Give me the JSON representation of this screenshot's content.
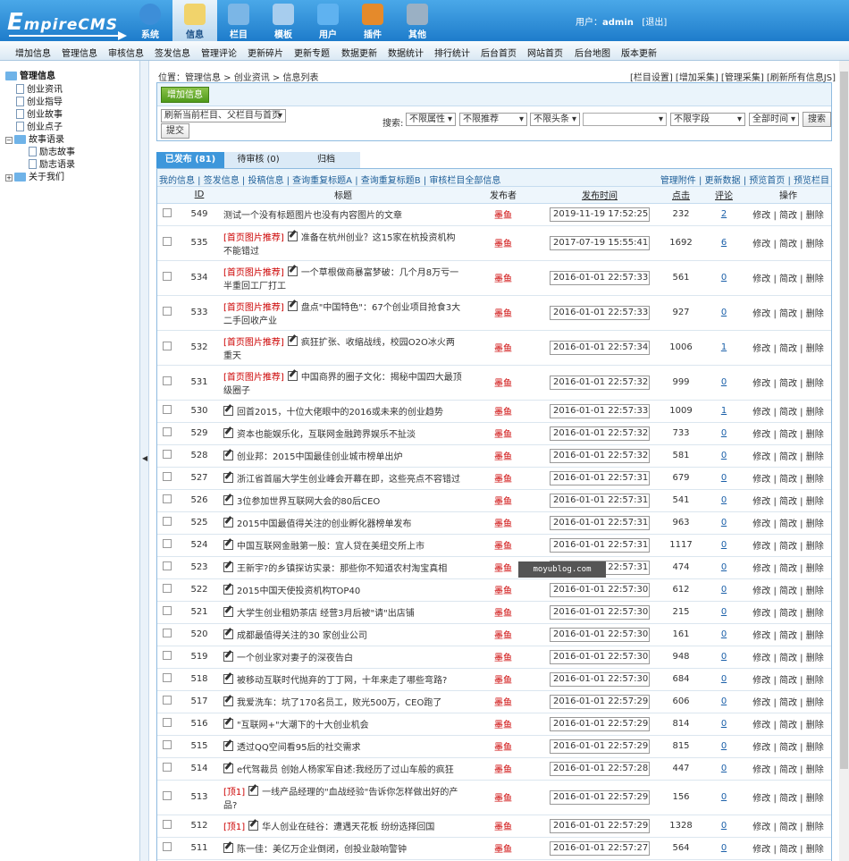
{
  "logo": {
    "prefix": "E",
    "text": "mpireCMS"
  },
  "nav": [
    {
      "label": "系统",
      "icon": "globe-icon",
      "color": "#3d8ed8"
    },
    {
      "label": "信息",
      "icon": "pencil-paper-icon",
      "color": "#f1d36b"
    },
    {
      "label": "栏目",
      "icon": "folder-icon",
      "color": "#7bb6e6"
    },
    {
      "label": "模板",
      "icon": "template-icon",
      "color": "#a7cdee"
    },
    {
      "label": "用户",
      "icon": "user-icon",
      "color": "#5fb2f0"
    },
    {
      "label": "插件",
      "icon": "tools-icon",
      "color": "#e58a2b"
    },
    {
      "label": "其他",
      "icon": "gear-icon",
      "color": "#9ab0c4"
    }
  ],
  "user": {
    "prefix": "用户：",
    "name": "admin",
    "logout": "[退出]"
  },
  "menu": [
    "增加信息",
    "管理信息",
    "审核信息",
    "签发信息",
    "管理评论",
    "更新碎片",
    "更新专题",
    "数据更新",
    "数据统计",
    "排行统计",
    "后台首页",
    "网站首页",
    "后台地图",
    "版本更新"
  ],
  "tree": {
    "root": "管理信息",
    "items": [
      "创业资讯",
      "创业指导",
      "创业故事",
      "创业点子"
    ],
    "group": "故事语录",
    "children": [
      "励志故事",
      "励志语录"
    ],
    "about": "关于我们"
  },
  "breadcrumb": {
    "prefix": "位置：",
    "path": [
      "管理信息",
      "创业资讯",
      "信息列表"
    ],
    "sep": " > "
  },
  "toplinks": "[栏目设置] [增加采集] [管理采集] [刷新所有信息JS]",
  "panel": {
    "add": "增加信息",
    "refresh": "刷新当前栏目、父栏目与首页",
    "submit": "提交",
    "search_label": "搜索:",
    "filters": [
      "不限属性",
      "不限推荐",
      "不限头条",
      "",
      "不限字段",
      "全部时间"
    ],
    "search_btn": "搜索"
  },
  "tabs": [
    "已发布 (81)",
    "待审核 (0)",
    "归档"
  ],
  "subbar": {
    "left": "我的信息 | 签发信息 | 投稿信息 | 查询重复标题A | 查询重复标题B | 审核栏目全部信息",
    "right": "管理附件 | 更新数据 | 预览首页 | 预览栏目"
  },
  "columns": [
    "ID",
    "标题",
    "发布者",
    "发布时间",
    "点击",
    "评论",
    "操作"
  ],
  "actions": "修改 | 简改 | 删除",
  "rows": [
    {
      "id": "549",
      "tag": "",
      "icon": false,
      "title": "测试一个没有标题图片也没有内容图片的文章",
      "author": "墨鱼",
      "time": "2019-11-19 17:52:25",
      "hits": "232",
      "comments": "2"
    },
    {
      "id": "535",
      "tag": "[首页图片推荐]",
      "icon": true,
      "title": "准备在杭州创业？这15家在杭投资机构不能错过",
      "author": "墨鱼",
      "time": "2017-07-19 15:55:41",
      "hits": "1692",
      "comments": "6"
    },
    {
      "id": "534",
      "tag": "[首页图片推荐]",
      "icon": true,
      "title": "一个草根做商暴富梦破：几个月8万亏一半重回工厂打工",
      "author": "墨鱼",
      "time": "2016-01-01 22:57:33",
      "hits": "561",
      "comments": "0"
    },
    {
      "id": "533",
      "tag": "[首页图片推荐]",
      "icon": true,
      "title": "盘点\"中国特色\"：67个创业项目抢食3大二手回收产业",
      "author": "墨鱼",
      "time": "2016-01-01 22:57:33",
      "hits": "927",
      "comments": "0"
    },
    {
      "id": "532",
      "tag": "[首页图片推荐]",
      "icon": true,
      "title": "疯狂扩张、收缩战线，校园O2O冰火两重天",
      "author": "墨鱼",
      "time": "2016-01-01 22:57:34",
      "hits": "1006",
      "comments": "1"
    },
    {
      "id": "531",
      "tag": "[首页图片推荐]",
      "icon": true,
      "title": "中国商界的圈子文化：揭秘中国四大最顶级圈子",
      "author": "墨鱼",
      "time": "2016-01-01 22:57:32",
      "hits": "999",
      "comments": "0"
    },
    {
      "id": "530",
      "tag": "",
      "icon": true,
      "title": "回首2015，十位大佬眼中的2016或未来的创业趋势",
      "author": "墨鱼",
      "time": "2016-01-01 22:57:33",
      "hits": "1009",
      "comments": "1"
    },
    {
      "id": "529",
      "tag": "",
      "icon": true,
      "title": "资本也能娱乐化，互联网金融跨界娱乐不扯淡",
      "author": "墨鱼",
      "time": "2016-01-01 22:57:32",
      "hits": "733",
      "comments": "0"
    },
    {
      "id": "528",
      "tag": "",
      "icon": true,
      "title": "创业邦：2015中国最佳创业城市榜单出炉",
      "author": "墨鱼",
      "time": "2016-01-01 22:57:32",
      "hits": "581",
      "comments": "0"
    },
    {
      "id": "527",
      "tag": "",
      "icon": true,
      "title": "浙江省首届大学生创业峰会开幕在即，这些亮点不容错过",
      "author": "墨鱼",
      "time": "2016-01-01 22:57:31",
      "hits": "679",
      "comments": "0"
    },
    {
      "id": "526",
      "tag": "",
      "icon": true,
      "title": "3位参加世界互联网大会的80后CEO",
      "author": "墨鱼",
      "time": "2016-01-01 22:57:31",
      "hits": "541",
      "comments": "0"
    },
    {
      "id": "525",
      "tag": "",
      "icon": true,
      "title": "2015中国最值得关注的创业孵化器榜单发布",
      "author": "墨鱼",
      "time": "2016-01-01 22:57:31",
      "hits": "963",
      "comments": "0"
    },
    {
      "id": "524",
      "tag": "",
      "icon": true,
      "title": "中国互联网金融第一股：宜人贷在美纽交所上市",
      "author": "墨鱼",
      "time": "2016-01-01 22:57:31",
      "hits": "1117",
      "comments": "0"
    },
    {
      "id": "523",
      "tag": "",
      "icon": true,
      "title": "王新宇?的乡镇探访实录：那些你不知道农村淘宝真相",
      "author": "墨鱼",
      "time": "2016-01-01 22:57:31",
      "hits": "474",
      "comments": "0"
    },
    {
      "id": "522",
      "tag": "",
      "icon": true,
      "title": "2015中国天使投资机构TOP40",
      "author": "墨鱼",
      "time": "2016-01-01 22:57:30",
      "hits": "612",
      "comments": "0"
    },
    {
      "id": "521",
      "tag": "",
      "icon": true,
      "title": "大学生创业租奶茶店 经营3月后被\"请\"出店铺",
      "author": "墨鱼",
      "time": "2016-01-01 22:57:30",
      "hits": "215",
      "comments": "0"
    },
    {
      "id": "520",
      "tag": "",
      "icon": true,
      "title": "成都最值得关注的30 家创业公司",
      "author": "墨鱼",
      "time": "2016-01-01 22:57:30",
      "hits": "161",
      "comments": "0"
    },
    {
      "id": "519",
      "tag": "",
      "icon": true,
      "title": "一个创业家对妻子的深夜告白",
      "author": "墨鱼",
      "time": "2016-01-01 22:57:30",
      "hits": "948",
      "comments": "0"
    },
    {
      "id": "518",
      "tag": "",
      "icon": true,
      "title": "被移动互联时代抛弃的丁丁网，十年来走了哪些弯路?",
      "author": "墨鱼",
      "time": "2016-01-01 22:57:30",
      "hits": "684",
      "comments": "0"
    },
    {
      "id": "517",
      "tag": "",
      "icon": true,
      "title": "我爱洗车：坑了170名员工，败光500万，CEO跑了",
      "author": "墨鱼",
      "time": "2016-01-01 22:57:29",
      "hits": "606",
      "comments": "0"
    },
    {
      "id": "516",
      "tag": "",
      "icon": true,
      "title": "\"互联网+\"大潮下的十大创业机会",
      "author": "墨鱼",
      "time": "2016-01-01 22:57:29",
      "hits": "814",
      "comments": "0"
    },
    {
      "id": "515",
      "tag": "",
      "icon": true,
      "title": "透过QQ空间看95后的社交需求",
      "author": "墨鱼",
      "time": "2016-01-01 22:57:29",
      "hits": "815",
      "comments": "0"
    },
    {
      "id": "514",
      "tag": "",
      "icon": true,
      "title": "e代驾裁员 创始人杨家军自述:我经历了过山车般的疯狂",
      "author": "墨鱼",
      "time": "2016-01-01 22:57:28",
      "hits": "447",
      "comments": "0"
    },
    {
      "id": "513",
      "tag": "[顶1]",
      "icon": true,
      "title": "一线产品经理的\"血战经验\"告诉你怎样做出好的产品?",
      "author": "墨鱼",
      "time": "2016-01-01 22:57:29",
      "hits": "156",
      "comments": "0"
    },
    {
      "id": "512",
      "tag": "[顶1]",
      "icon": true,
      "title": "华人创业在硅谷：遭遇天花板 纷纷选择回国",
      "author": "墨鱼",
      "time": "2016-01-01 22:57:29",
      "hits": "1328",
      "comments": "0"
    },
    {
      "id": "511",
      "tag": "",
      "icon": true,
      "title": "陈一佳：美亿万企业倒闭，创投业敲响警钟",
      "author": "墨鱼",
      "time": "2016-01-01 22:57:27",
      "hits": "564",
      "comments": "0"
    }
  ],
  "watermark": "moyublog.com"
}
